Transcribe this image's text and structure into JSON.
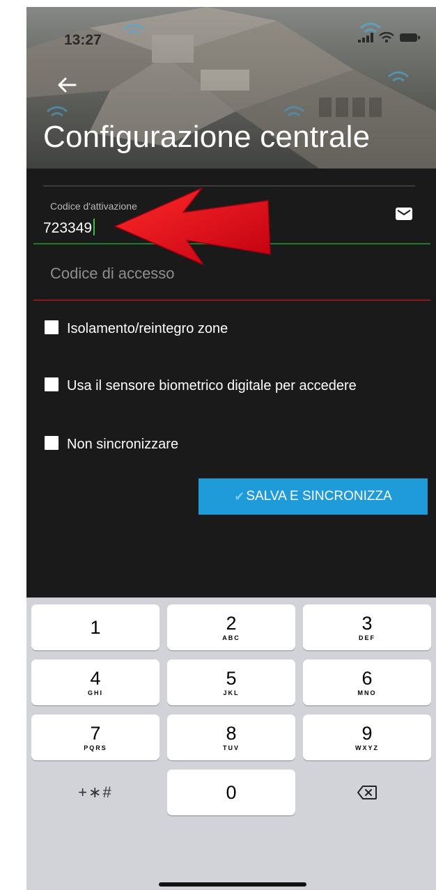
{
  "status_bar": {
    "time": "13:27",
    "icons": [
      "signal-icon",
      "wifi-icon",
      "battery-icon"
    ]
  },
  "header": {
    "back_icon": "arrow-left-icon",
    "title": "Configurazione centrale"
  },
  "form": {
    "activation_code": {
      "label": "Codice d'attivazione",
      "value": "723349",
      "icon": "mail-icon"
    },
    "access_code": {
      "placeholder": "Codice di accesso"
    },
    "checkboxes": [
      {
        "label": "Isolamento/reintegro zone",
        "checked": false
      },
      {
        "label": "Usa il sensore biometrico digitale per accedere",
        "checked": false
      },
      {
        "label": "Non sincronizzare",
        "checked": false
      }
    ],
    "save_button": {
      "icon": "✔",
      "label": "SALVA E SINCRONIZZA"
    }
  },
  "annotation": {
    "type": "arrow",
    "color": "#e3111d"
  },
  "keyboard": {
    "keys": [
      {
        "num": "1",
        "letters": ""
      },
      {
        "num": "2",
        "letters": "ABC"
      },
      {
        "num": "3",
        "letters": "DEF"
      },
      {
        "num": "4",
        "letters": "GHI"
      },
      {
        "num": "5",
        "letters": "JKL"
      },
      {
        "num": "6",
        "letters": "MNO"
      },
      {
        "num": "7",
        "letters": "PQRS"
      },
      {
        "num": "8",
        "letters": "TUV"
      },
      {
        "num": "9",
        "letters": "WXYZ"
      },
      {
        "num": "0",
        "letters": ""
      }
    ],
    "symbols": "+∗#",
    "delete_icon": "backspace-icon"
  },
  "colors": {
    "accent_blue": "#1e9bd8",
    "valid_green": "#1f7a2d",
    "error_red": "#8a1c1c",
    "background": "#1a1a1a"
  }
}
